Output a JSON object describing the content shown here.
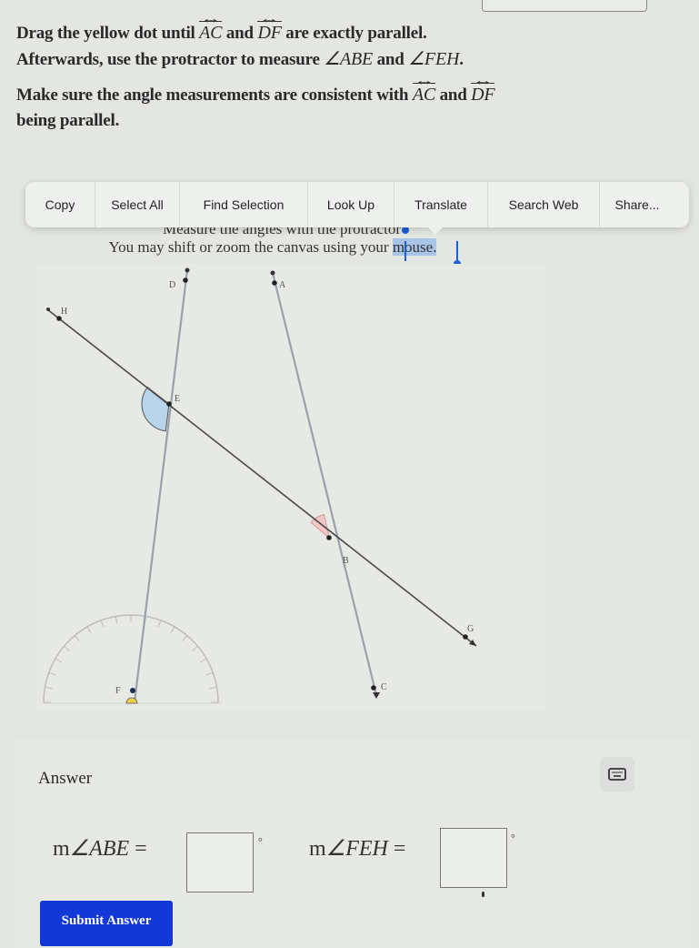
{
  "instructions": {
    "line1_a": "Drag the yellow dot until ",
    "line1_b": " and ",
    "line1_c": " are exactly parallel.",
    "line2_a": "Afterwards, use the protractor to measure ",
    "line2_b": " and ",
    "line2_c": ".",
    "line3_a": "Make sure the angle measurements are consistent with ",
    "line3_b": " and ",
    "line4": "being parallel.",
    "line_ac": "AC",
    "line_df": "DF",
    "angle_abe": "∠ABE",
    "angle_feh": "∠FEH"
  },
  "context_menu": {
    "items": [
      "Copy",
      "Select All",
      "Find Selection",
      "Look Up",
      "Translate",
      "Search Web",
      "Share..."
    ]
  },
  "canvas": {
    "caption1": "Measure the angles with the protractor",
    "caption2_a": "You may shift or zoom the canvas using your ",
    "caption2_selected": "mouse.",
    "points": {
      "A": "A",
      "B": "B",
      "C": "C",
      "D": "D",
      "E": "E",
      "F": "F",
      "G": "G",
      "H": "H"
    },
    "angle_colors": {
      "feh": "#b8d4ea",
      "abe": "#f4c6c6"
    },
    "draggable_dot_color": "#e8d04a"
  },
  "answer": {
    "title": "Answer",
    "eq1_prefix": "m",
    "eq1_angle": "∠ABE",
    "eq2_prefix": "m",
    "eq2_angle": "∠FEH",
    "equals": "=",
    "degree": "°",
    "input1_value": "",
    "input2_value": "",
    "submit_label": "Submit Answer",
    "submit_color": "#1338d8"
  }
}
